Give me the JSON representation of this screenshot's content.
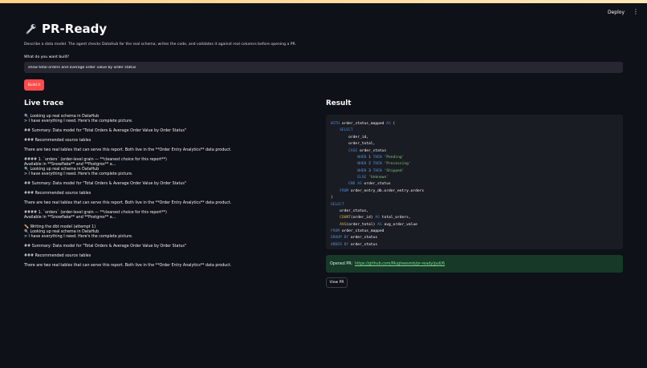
{
  "header": {
    "deploy_label": "Deploy",
    "menu_icon": "more-vertical-icon"
  },
  "page": {
    "title": "PR-Ready",
    "title_icon": "wrench-icon",
    "description": "Describe a data model. The agent checks DataHub for the real schema, writes the code, and validates it against real columns before opening a PR.",
    "ask_label": "What do you want built?",
    "ask_value": "show total orders and average order value by order status",
    "build_label": "Build it"
  },
  "trace": {
    "title": "Live trace",
    "lines": [
      "🔍 Looking up real schema in DataHub",
      "> I have everything I need. Here's the complete picture.",
      "",
      "## Summary: Data model for \"Total Orders & Average Order Value by Order Status\"",
      "",
      "### Recommended source tables",
      "",
      "There are two real tables that can serve this report. Both live in the **Order Entry Analytics** data product.",
      "",
      "#### 1. `orders` (order-level grain — **cleanest choice for this report**)",
      "Available in **Snowflake** and **Postgres** a...",
      "🔍 Looking up real schema in DataHub",
      "> I have everything I need. Here's the complete picture.",
      "",
      "## Summary: Data model for \"Total Orders & Average Order Value by Order Status\"",
      "",
      "### Recommended source tables",
      "",
      "There are two real tables that can serve this report. Both live in the **Order Entry Analytics** data product.",
      "",
      "#### 1. `orders` (order-level grain — **cleanest choice for this report**)",
      "Available in **Snowflake** and **Postgres** a...",
      "",
      "✏️ Writing the dbt model (attempt 1)",
      "🔍 Looking up real schema in DataHub",
      "> I have everything I need. Here's the complete picture.",
      "",
      "## Summary: Data model for \"Total Orders & Average Order Value by Order Status\"",
      "",
      "### Recommended source tables",
      "",
      "There are two real tables that can serve this report. Both live in the **Order Entry Analytics** data product."
    ]
  },
  "result": {
    "title": "Result",
    "sql": "WITH order_status_mapped AS (\n    SELECT\n        order_id,\n        order_total,\n        CASE order_status\n            WHEN 1 THEN 'Pending'\n            WHEN 2 THEN 'Processing'\n            WHEN 3 THEN 'Shipped'\n            ELSE 'Unknown'\n        END AS order_status\n    FROM order_entry_db.order_entry.orders\n)\nSELECT\n    order_status,\n    COUNT(order_id) AS total_orders,\n    AVG(order_total) AS avg_order_value\nFROM order_status_mapped\nGROUP BY order_status\nORDER BY order_status",
    "pr_prefix": "Opened PR:",
    "pr_url": "https://github.com/Mugheesmb/pr-ready/pull/6",
    "view_pr_label": "View PR"
  },
  "colors": {
    "background": "#0e1117",
    "accent": "#ff4b4b",
    "success_bg": "#173928",
    "success_link": "#7be08f",
    "input_bg": "#262730",
    "code_bg": "#1a1c24"
  }
}
